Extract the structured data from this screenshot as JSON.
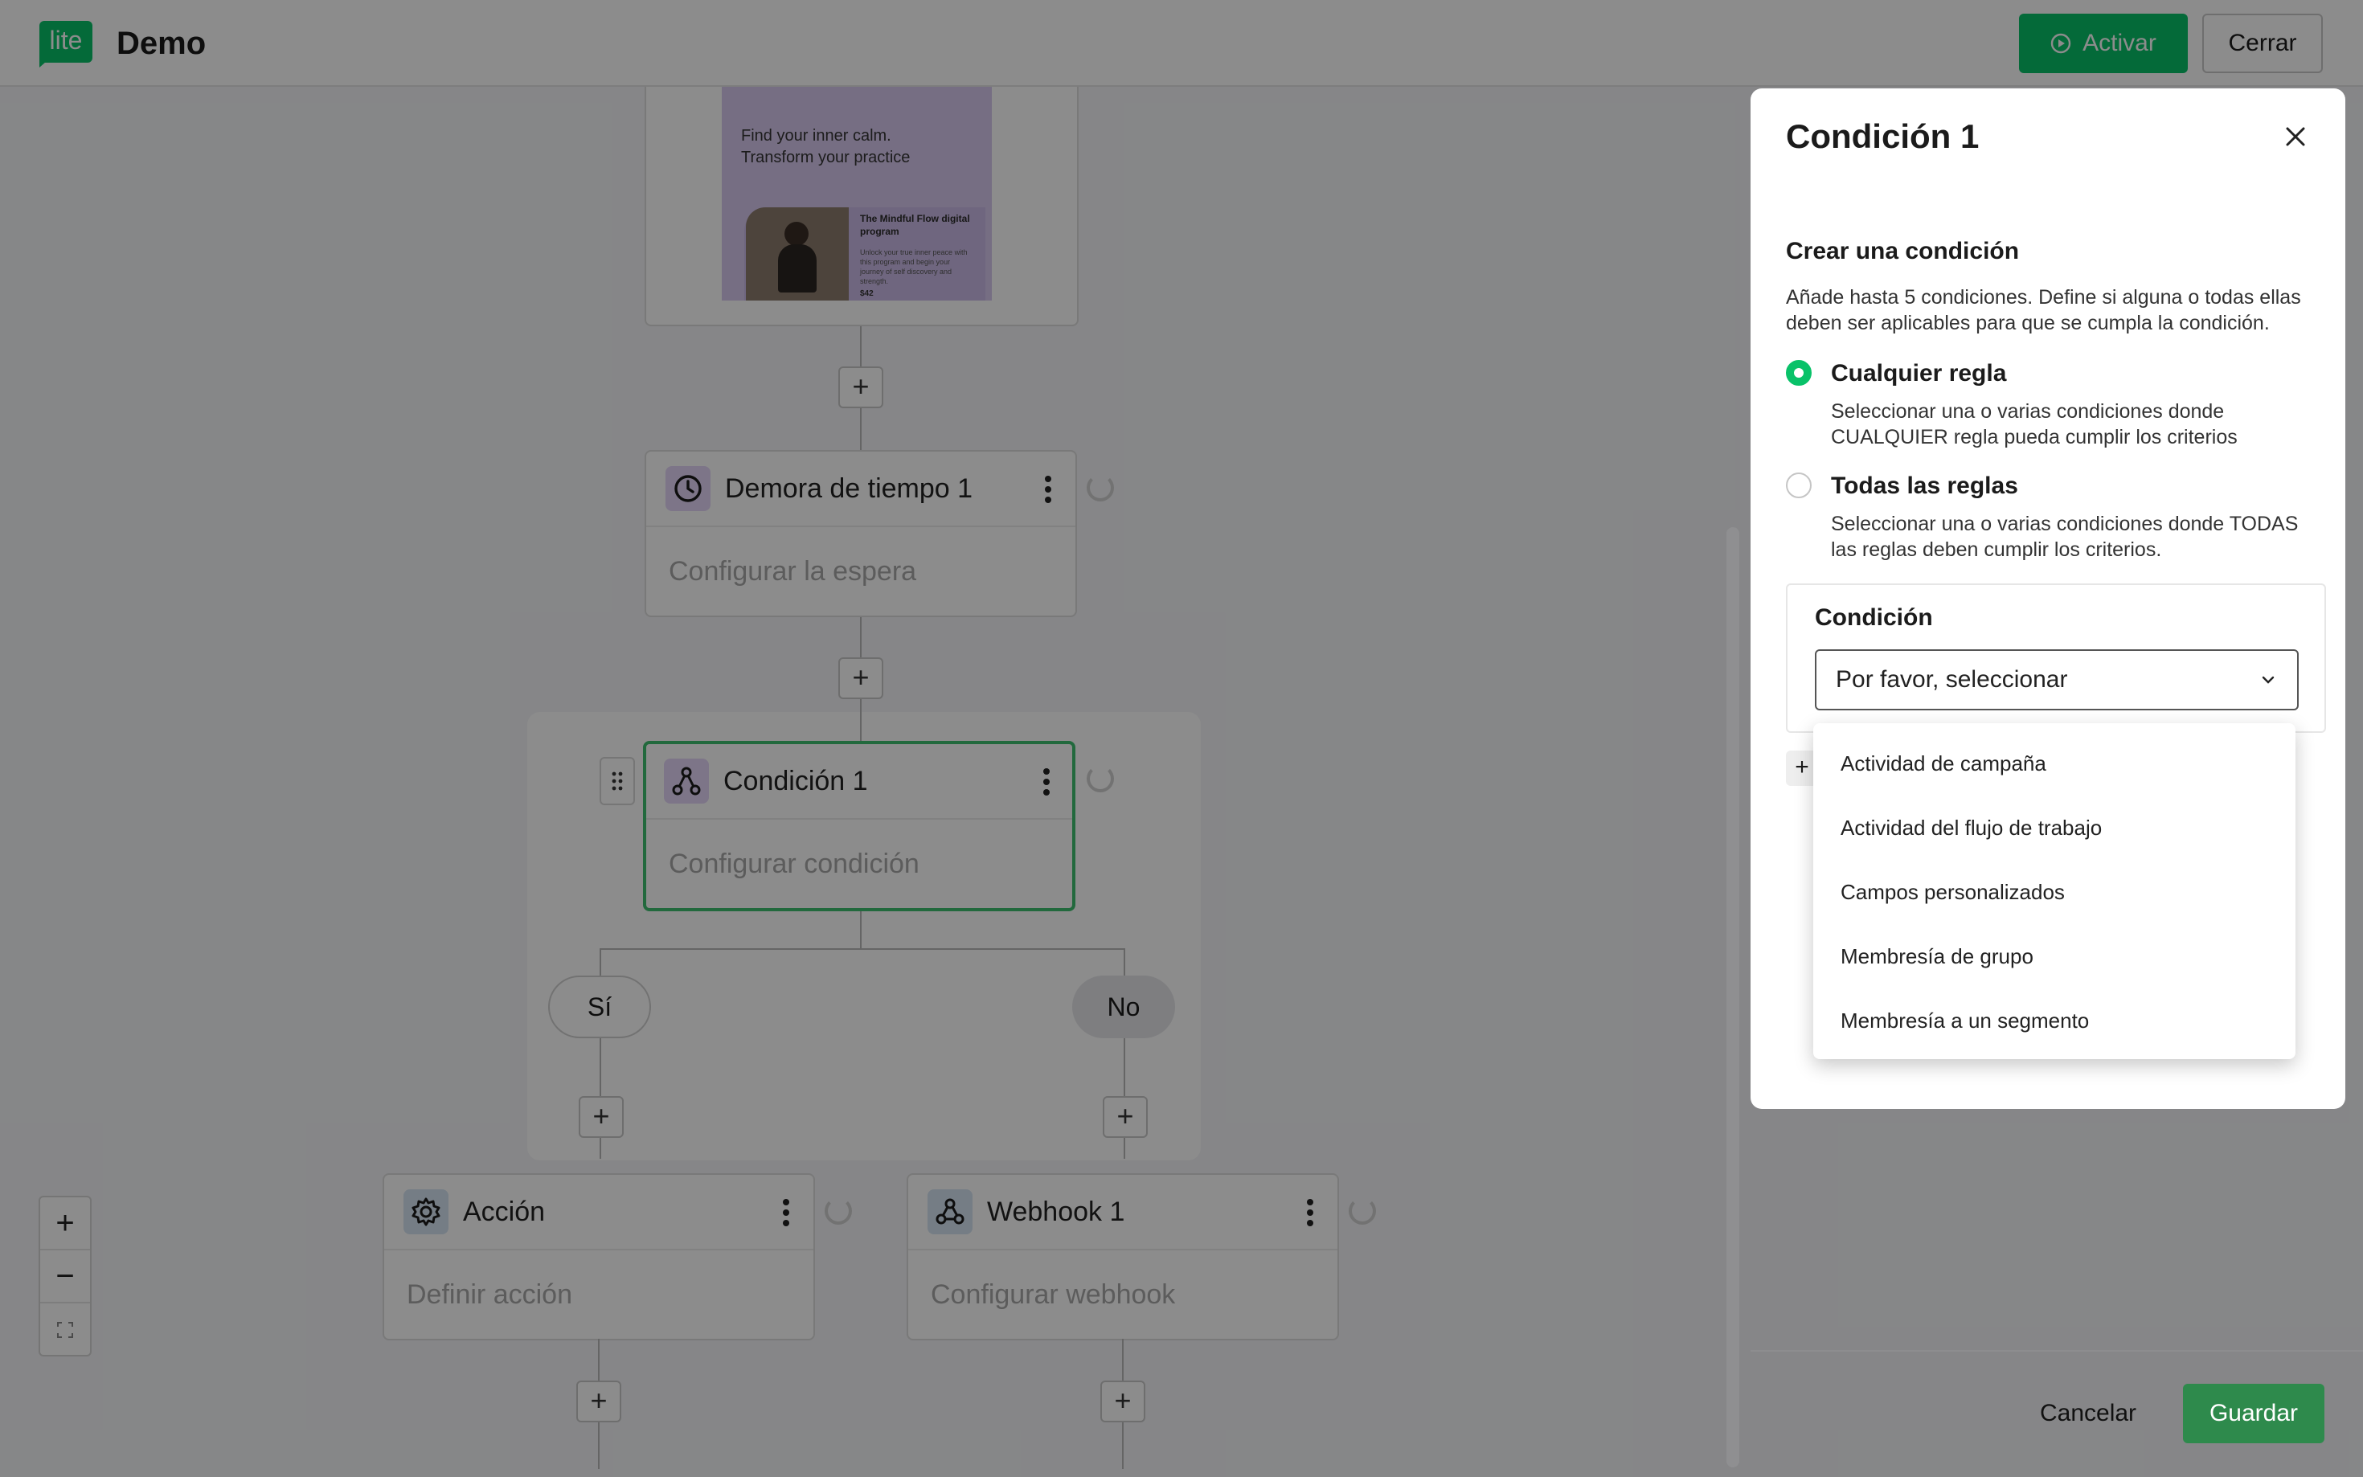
{
  "header": {
    "logo_text": "lite",
    "title": "Demo",
    "activate_label": "Activar",
    "close_label": "Cerrar"
  },
  "canvas": {
    "email_preview": {
      "headline_1": "Find your inner calm.",
      "headline_2": "Transform your practice",
      "card_title": "The Mindful Flow digital program",
      "card_text": "Unlock your true inner peace with this program and begin your journey of self discovery and strength.",
      "price": "$42"
    },
    "delay_node": {
      "title": "Demora de tiempo 1",
      "body": "Configurar la espera",
      "icon": "clock-icon"
    },
    "condition_node": {
      "title": "Condición 1",
      "body": "Configurar condición",
      "icon": "branch-icon"
    },
    "branch_yes": "Sí",
    "branch_no": "No",
    "action_node": {
      "title": "Acción",
      "body": "Definir acción",
      "icon": "gear-icon"
    },
    "webhook_node": {
      "title": "Webhook 1",
      "body": "Configurar webhook",
      "icon": "webhook-icon"
    },
    "plus_label": "+",
    "zoom": {
      "in": "+",
      "out": "−"
    }
  },
  "panel": {
    "title": "Condición 1",
    "section_title": "Crear una condición",
    "section_desc": "Añade hasta 5 condiciones. Define si alguna o todas ellas deben ser aplicables para que se cumpla la condición.",
    "options": [
      {
        "label": "Cualquier regla",
        "desc": "Seleccionar una o varias condiciones donde CUALQUIER regla pueda cumplir los criterios",
        "selected": true
      },
      {
        "label": "Todas las reglas",
        "desc": "Seleccionar una o varias condiciones donde TODAS las reglas deben cumplir los criterios.",
        "selected": false
      }
    ],
    "condition_label": "Condición",
    "select_placeholder": "Por favor, seleccionar",
    "add_stub": "+",
    "dropdown_options": [
      "Actividad de campaña",
      "Actividad del flujo de trabajo",
      "Campos personalizados",
      "Membresía de grupo",
      "Membresía a un segmento"
    ],
    "cancel_label": "Cancelar",
    "save_label": "Guardar"
  },
  "colors": {
    "brand_green": "#09c269",
    "save_green": "#2e8a4c",
    "selected_border": "#3fbf6f",
    "icon_purple": "#e3d6f7",
    "icon_blue": "#d5e4f3"
  }
}
